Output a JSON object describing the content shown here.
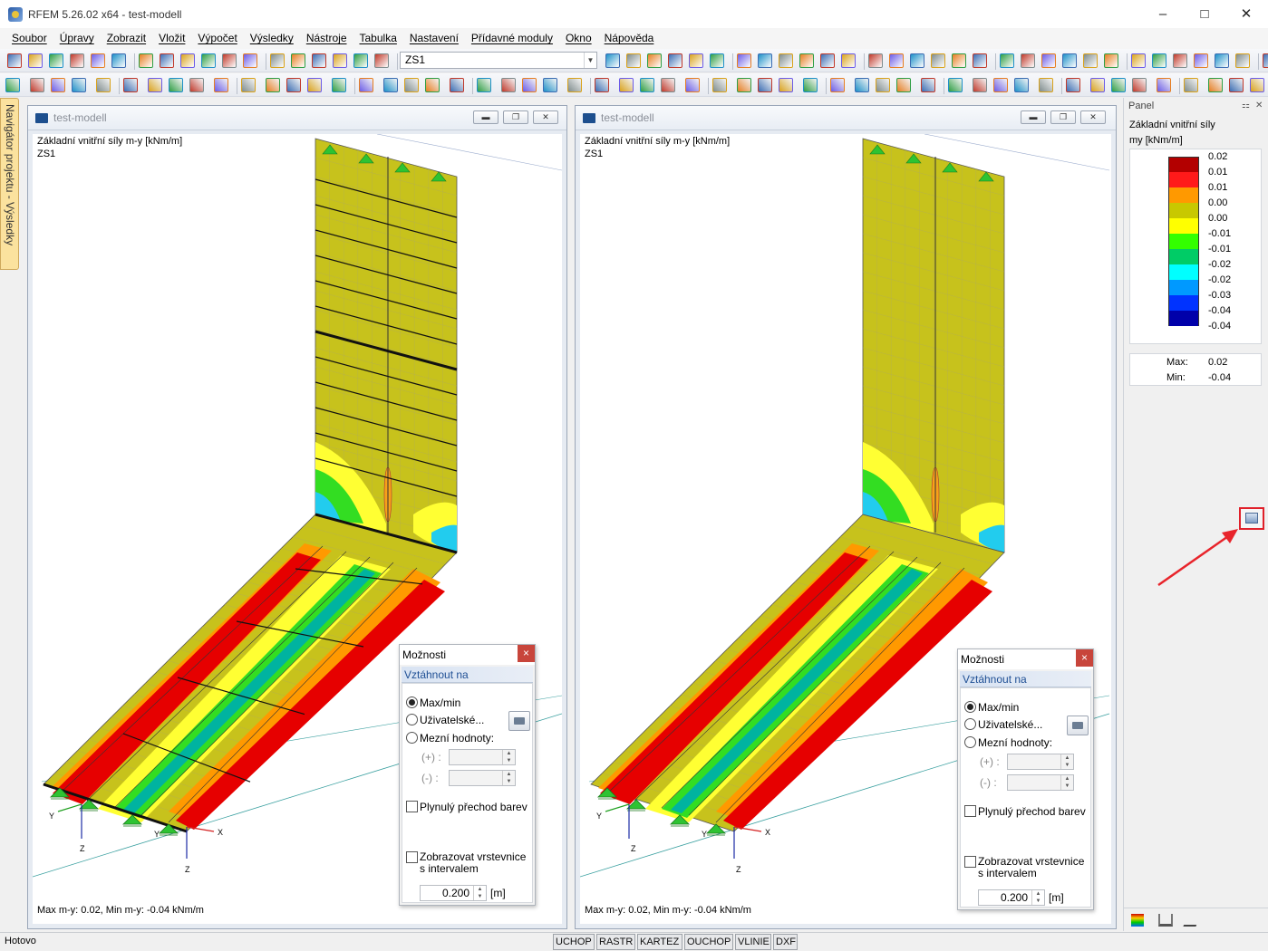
{
  "window": {
    "title": "RFEM 5.26.02 x64 - test-modell",
    "minimize": "–",
    "maximize": "□",
    "close": "✕"
  },
  "menu": [
    "Soubor",
    "Úpravy",
    "Zobrazit",
    "Vložit",
    "Výpočet",
    "Výsledky",
    "Nástroje",
    "Tabulka",
    "Nastavení",
    "Přídavné moduly",
    "Okno",
    "Nápověda"
  ],
  "toolbar": {
    "load_case": "ZS1",
    "icons_row1": [
      "new-file-icon",
      "open-file-icon",
      "open-folder-icon",
      "model-icon",
      "save-icon",
      "print-icon",
      "print-preview-icon",
      "print-report-icon",
      "undo-icon",
      "redo-icon",
      "edit-icon",
      "zoom-icon",
      "search-icon",
      "copy-icon",
      "paste-icon",
      "table-icon",
      "grid-icon"
    ],
    "icons_row2": [
      "node-icon",
      "line-icon",
      "member-icon",
      "support-icon",
      "surface-icon",
      "load-icon",
      "solid-icon",
      "section-icon",
      "view-icon",
      "render-icon",
      "results-icon",
      "settings-icon"
    ]
  },
  "navigator": {
    "label": "Navigátor projektu - Výsledky"
  },
  "views": [
    {
      "window_title": "test-modell",
      "line1": "Základní vnitřní síly m-y [kNm/m]",
      "line2": "ZS1",
      "footer": "Max m-y: 0.02, Min m-y: -0.04 kNm/m",
      "axis_labels": {
        "y1": "Y",
        "z1": "Z",
        "y2": "Y",
        "x2": "X",
        "z2": "Z"
      }
    },
    {
      "window_title": "test-modell",
      "line1": "Základní vnitřní síly m-y [kNm/m]",
      "line2": "ZS1",
      "footer": "Max m-y: 0.02, Min m-y: -0.04 kNm/m",
      "axis_labels": {
        "y1": "Y",
        "z1": "Z",
        "y2": "Y",
        "x2": "X",
        "z2": "Z"
      }
    }
  ],
  "options_dialog": {
    "title": "Možnosti",
    "section": "Vztáhnout na",
    "radio_maxmin": "Max/min",
    "radio_user": "Uživatelské...",
    "radio_limits": "Mezní hodnoty:",
    "plus_label": "(+) :",
    "minus_label": "(-) :",
    "smooth_label": "Plynulý přechod barev",
    "contour_label": "Zobrazovat vrstevnice s intervalem",
    "interval_value": "0.200",
    "interval_unit": "[m]",
    "close": "×"
  },
  "panel": {
    "header": "Panel",
    "title": "Základní vnitřní síly",
    "unit": "my [kNm/m]",
    "legend": [
      {
        "color": "#b30000",
        "value": "0.02"
      },
      {
        "color": "#ff1a1a",
        "value": "0.01"
      },
      {
        "color": "#ff9900",
        "value": "0.01"
      },
      {
        "color": "#c8c800",
        "value": "0.00"
      },
      {
        "color": "#ffff00",
        "value": "0.00"
      },
      {
        "color": "#33ff00",
        "value": "-0.01"
      },
      {
        "color": "#00cc66",
        "value": "-0.01"
      },
      {
        "color": "#00ffff",
        "value": "-0.02"
      },
      {
        "color": "#0099ff",
        "value": "-0.02"
      },
      {
        "color": "#0033ff",
        "value": "-0.03"
      },
      {
        "color": "#0000aa",
        "value": "-0.04"
      }
    ],
    "legend_last": "-0.04",
    "max_label": "Max:",
    "max_value": "0.02",
    "min_label": "Min:",
    "min_value": "-0.04"
  },
  "statusbar": {
    "text": "Hotovo",
    "buttons": [
      "UCHOP",
      "RASTR",
      "KARTEZ",
      "OUCHOP",
      "VLINIE",
      "DXF"
    ]
  }
}
